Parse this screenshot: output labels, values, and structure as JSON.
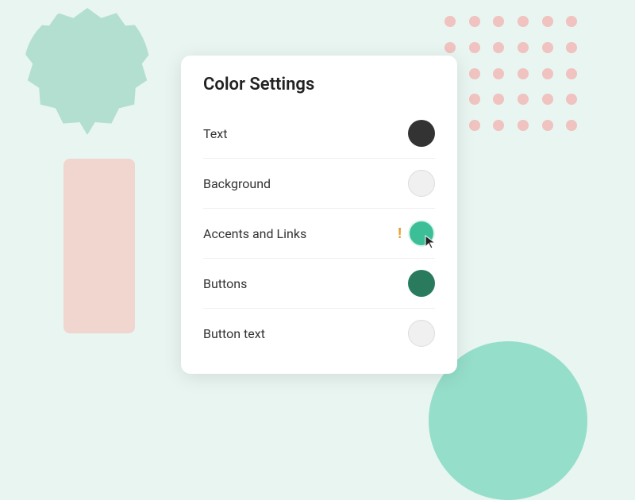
{
  "background": {
    "blob_color": "#b2dfd0",
    "rect_color": "#f5c8c0",
    "dots_color": "#f5a0a0",
    "circle_color": "#5ecfb0"
  },
  "card": {
    "title": "Color Settings",
    "settings": [
      {
        "id": "text",
        "label": "Text",
        "swatch_type": "dark",
        "swatch_color": "#333333",
        "has_warning": false
      },
      {
        "id": "background",
        "label": "Background",
        "swatch_type": "light",
        "swatch_color": "#f0f0f0",
        "has_warning": false
      },
      {
        "id": "accents",
        "label": "Accents and Links",
        "swatch_type": "teal",
        "swatch_color": "#3cbf97",
        "has_warning": true,
        "warning_symbol": "!"
      },
      {
        "id": "buttons",
        "label": "Buttons",
        "swatch_type": "green",
        "swatch_color": "#2a7a5e",
        "has_warning": false
      },
      {
        "id": "button-text",
        "label": "Button text",
        "swatch_type": "light",
        "swatch_color": "#f0f0f0",
        "has_warning": false
      }
    ]
  }
}
